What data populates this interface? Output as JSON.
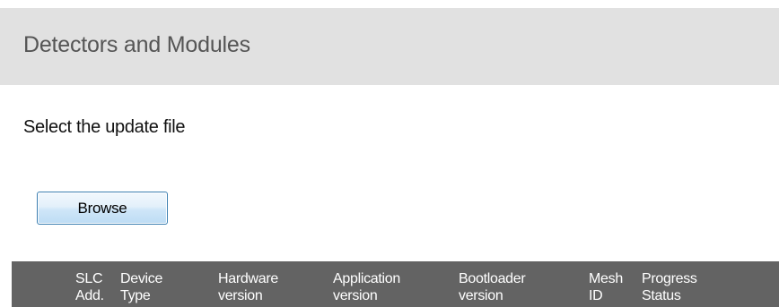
{
  "section": {
    "title": "Detectors and Modules"
  },
  "update": {
    "prompt": "Select the update file",
    "browse_label": "Browse"
  },
  "table": {
    "columns": [
      {
        "line1": "SLC",
        "line2": "Add."
      },
      {
        "line1": "Device",
        "line2": "Type"
      },
      {
        "line1": "Hardware",
        "line2": "version"
      },
      {
        "line1": "Application",
        "line2": "version"
      },
      {
        "line1": "Bootloader",
        "line2": "version"
      },
      {
        "line1": "Mesh",
        "line2": "ID"
      },
      {
        "line1": "Progress",
        "line2": "Status"
      }
    ]
  },
  "colors": {
    "header_bg": "#e1e1e1",
    "table_header_bg": "#636363",
    "button_border": "#3c7fb1"
  }
}
